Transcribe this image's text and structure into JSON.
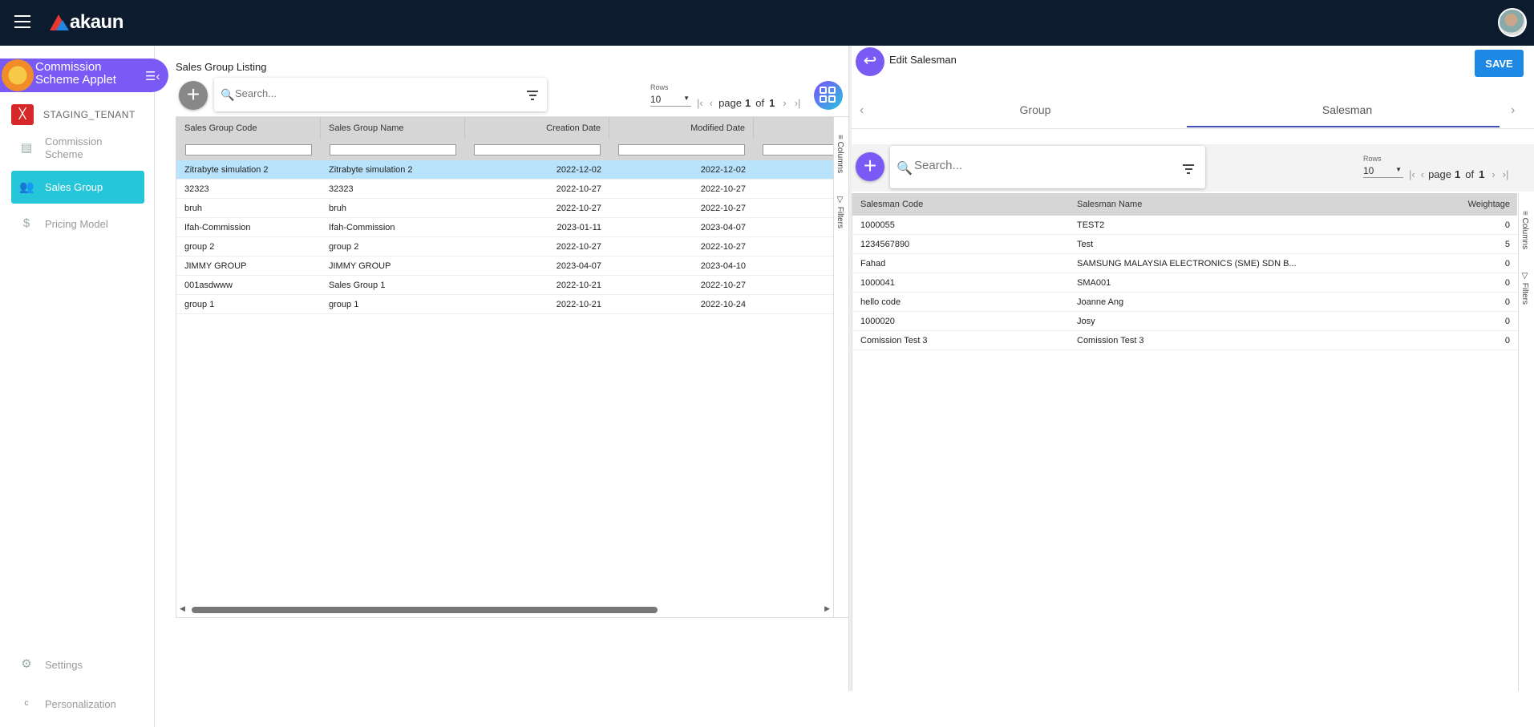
{
  "app": {
    "brand": "akaun"
  },
  "sidebar": {
    "applet_title": "Commission Scheme Applet",
    "tenant": "STAGING_TENANT",
    "items": [
      {
        "label": "Commission Scheme",
        "icon": "table-icon"
      },
      {
        "label": "Sales Group",
        "icon": "users-icon",
        "active": true
      },
      {
        "label": "Pricing Model",
        "icon": "dollar-icon"
      }
    ],
    "settings_label": "Settings",
    "personalization_label": "Personalization",
    "personalization_alt": "c"
  },
  "left": {
    "title": "Sales Group Listing",
    "search_placeholder": "Search...",
    "rows_label": "Rows",
    "rows_value": "10",
    "page_label": "page",
    "page_current": "1",
    "page_of": "of",
    "page_total": "1",
    "columns": [
      "Sales Group Code",
      "Sales Group Name",
      "Creation Date",
      "Modified Date"
    ],
    "side_tabs": [
      "Columns",
      "Filters"
    ],
    "rows": [
      [
        "Zitrabyte simulation 2",
        "Zitrabyte simulation 2",
        "2022-12-02",
        "2022-12-02"
      ],
      [
        "32323",
        "32323",
        "2022-10-27",
        "2022-10-27"
      ],
      [
        "bruh",
        "bruh",
        "2022-10-27",
        "2022-10-27"
      ],
      [
        "Ifah-Commission",
        "Ifah-Commission",
        "2023-01-11",
        "2023-04-07"
      ],
      [
        "group 2",
        "group 2",
        "2022-10-27",
        "2022-10-27"
      ],
      [
        "JIMMY GROUP",
        "JIMMY GROUP",
        "2023-04-07",
        "2023-04-10"
      ],
      [
        "001asdwww",
        "Sales Group 1",
        "2022-10-21",
        "2022-10-27"
      ],
      [
        "group 1",
        "group 1",
        "2022-10-21",
        "2022-10-24"
      ]
    ]
  },
  "right": {
    "title": "Edit Salesman",
    "save_label": "SAVE",
    "tabs": [
      "Group",
      "Salesman"
    ],
    "active_tab": "Salesman",
    "search_placeholder": "Search...",
    "rows_label": "Rows",
    "rows_value": "10",
    "page_label": "page",
    "page_current": "1",
    "page_of": "of",
    "page_total": "1",
    "columns": [
      "Salesman Code",
      "Salesman Name",
      "Weightage"
    ],
    "side_tabs": [
      "Columns",
      "Filters"
    ],
    "rows": [
      [
        "1000055",
        "TEST2",
        "0"
      ],
      [
        "1234567890",
        "Test",
        "5"
      ],
      [
        "Fahad",
        "SAMSUNG MALAYSIA ELECTRONICS (SME) SDN B...",
        "0"
      ],
      [
        "1000041",
        "SMA001",
        "0"
      ],
      [
        "hello code",
        "Joanne Ang",
        "0"
      ],
      [
        "1000020",
        "Josy",
        "0"
      ],
      [
        "Comission Test 3",
        "Comission Test 3",
        "0"
      ]
    ]
  },
  "colors": {
    "topbar": "#0d1b2e",
    "accent": "#26c6da",
    "applet": "#7a5af5",
    "save": "#1e88e5",
    "selected_row": "#b8e3fb"
  }
}
